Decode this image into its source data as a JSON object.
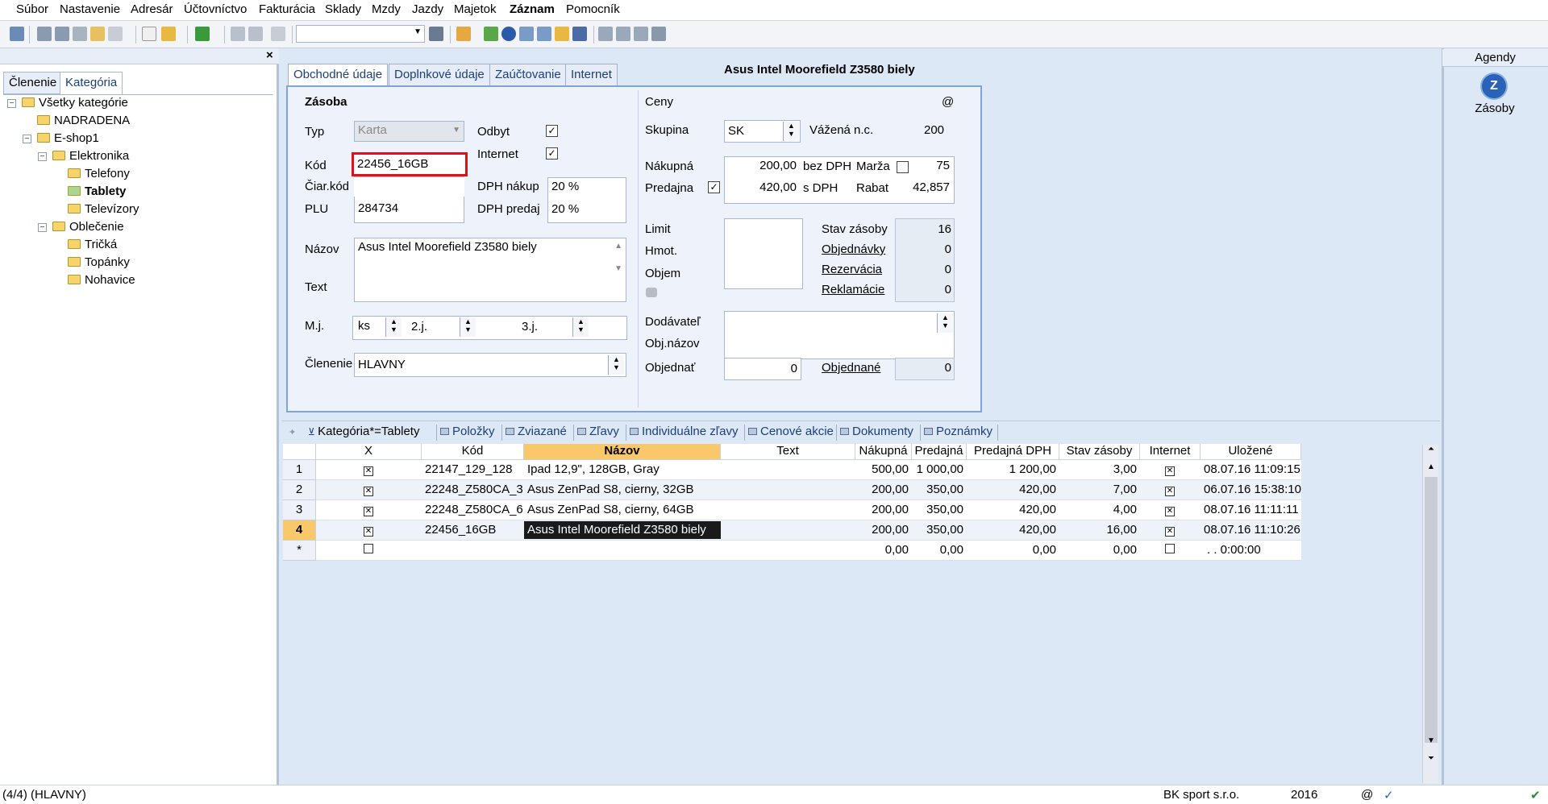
{
  "menu": [
    "Súbor",
    "Nastavenie",
    "Adresár",
    "Účtovníctvo",
    "Fakturácia",
    "Sklady",
    "Mzdy",
    "Jazdy",
    "Majetok",
    "Záznam",
    "Pomocník"
  ],
  "left_panel": {
    "close_label": "×",
    "tabs": [
      "Členenie",
      "Kategória"
    ],
    "tree": [
      "Všetky kategórie",
      "NADRADENA",
      "E-shop1",
      "Elektronika",
      "Telefony",
      "Tablety",
      "Televízory",
      "Oblečenie",
      "Tričká",
      "Topánky",
      "Nohavice"
    ]
  },
  "form": {
    "tabs": [
      "Obchodné údaje",
      "Doplnkové údaje",
      "Zaúčtovanie",
      "Internet"
    ],
    "record_title": "Asus Intel Moorefield Z3580 biely",
    "section_title": "Zásoba",
    "prices_title": "Ceny",
    "at_label": "@",
    "typ_label": "Typ",
    "typ_value": "Karta",
    "odbyt_label": "Odbyt",
    "internet_label": "Internet",
    "kod_label": "Kód",
    "kod_value": "22456_16GB",
    "ciarkod_label": "Čiar.kód",
    "ciarkod_value": "",
    "plu_label": "PLU",
    "plu_value": "284734",
    "dph_nakup_label": "DPH nákup",
    "dph_nakup_value": "20 %",
    "dph_predaj_label": "DPH predaj",
    "dph_predaj_value": "20 %",
    "nazov_label": "Názov",
    "nazov_value": "Asus Intel Moorefield Z3580 biely",
    "text_label": "Text",
    "mj_label": "M.j.",
    "mj_value": "ks",
    "j2_label": "2.j.",
    "j3_label": "3.j.",
    "clenenie_label": "Členenie",
    "clenenie_value": "HLAVNY",
    "skupina_label": "Skupina",
    "skupina_value": "SK",
    "vazena_label": "Vážená n.c.",
    "vazena_value": "200",
    "nakupna_label": "Nákupná",
    "nakupna_value": "200,00",
    "bez_dph": "bez DPH",
    "predajna_label": "Predajna",
    "predajna_value": "420,00",
    "s_dph": "s DPH",
    "marza_label": "Marža",
    "marza_value": "75",
    "rabat_label": "Rabat",
    "rabat_value": "42,857",
    "limit_label": "Limit",
    "hmot_label": "Hmot.",
    "objem_label": "Objem",
    "stav_label": "Stav zásoby",
    "stav_value": "16",
    "objednavky_label": "Objednávky",
    "objednavky_value": "0",
    "rezervacia_label": "Rezervácia",
    "rezervacia_value": "0",
    "reklamacie_label": "Reklamácie",
    "reklamacie_value": "0",
    "dodavatel_label": "Dodávateľ",
    "objnazov_label": "Obj.názov",
    "objednat_label": "Objednať",
    "objednat_value": "0",
    "objednane_label": "Objednané",
    "objednane_value": "0"
  },
  "right_panel": {
    "title": "Agendy",
    "item": "Zásoby"
  },
  "bottom_tabs": [
    "Kategória*=Tablety",
    "Položky",
    "Zviazané",
    "Zľavy",
    "Individuálne zľavy",
    "Cenové akcie",
    "Dokumenty",
    "Poznámky"
  ],
  "grid": {
    "headers": [
      "X",
      "Kód",
      "Názov",
      "Text",
      "Nákupná",
      "Predajná",
      "Predajná DPH",
      "Stav zásoby",
      "Internet",
      "Uložené"
    ],
    "rows": [
      {
        "num": "1",
        "kod": "22147_129_128",
        "nazov": "Ipad 12,9\", 128GB, Gray",
        "text": "",
        "nakupna": "500,00",
        "predajna": "1 000,00",
        "predajna_dph": "1 200,00",
        "stav": "3,00",
        "ulozene": "08.07.16 11:09:15"
      },
      {
        "num": "2",
        "kod": "22248_Z580CA_3",
        "nazov": "Asus ZenPad S8, cierny, 32GB",
        "text": "",
        "nakupna": "200,00",
        "predajna": "350,00",
        "predajna_dph": "420,00",
        "stav": "7,00",
        "ulozene": "06.07.16 15:38:10"
      },
      {
        "num": "3",
        "kod": "22248_Z580CA_6",
        "nazov": "Asus ZenPad S8, cierny, 64GB",
        "text": "",
        "nakupna": "200,00",
        "predajna": "350,00",
        "predajna_dph": "420,00",
        "stav": "4,00",
        "ulozene": "08.07.16 11:11:11"
      },
      {
        "num": "4",
        "kod": "22456_16GB",
        "nazov": "Asus Intel Moorefield Z3580 biely",
        "text": "",
        "nakupna": "200,00",
        "predajna": "350,00",
        "predajna_dph": "420,00",
        "stav": "16,00",
        "ulozene": "08.07.16 11:10:26"
      }
    ],
    "new_row": {
      "num": "*",
      "nakupna": "0,00",
      "predajna": "0,00",
      "predajna_dph": "0,00",
      "stav": "0,00",
      "ulozene": ". .  0:00:00"
    }
  },
  "status": {
    "left": "(4/4) (HLAVNY)",
    "company": "BK sport  s.r.o.",
    "year": "2016",
    "at": "@"
  },
  "colors": {
    "accent": "#7fa4d8",
    "selection": "#f8c86a",
    "highlight_border": "#e0101a"
  }
}
